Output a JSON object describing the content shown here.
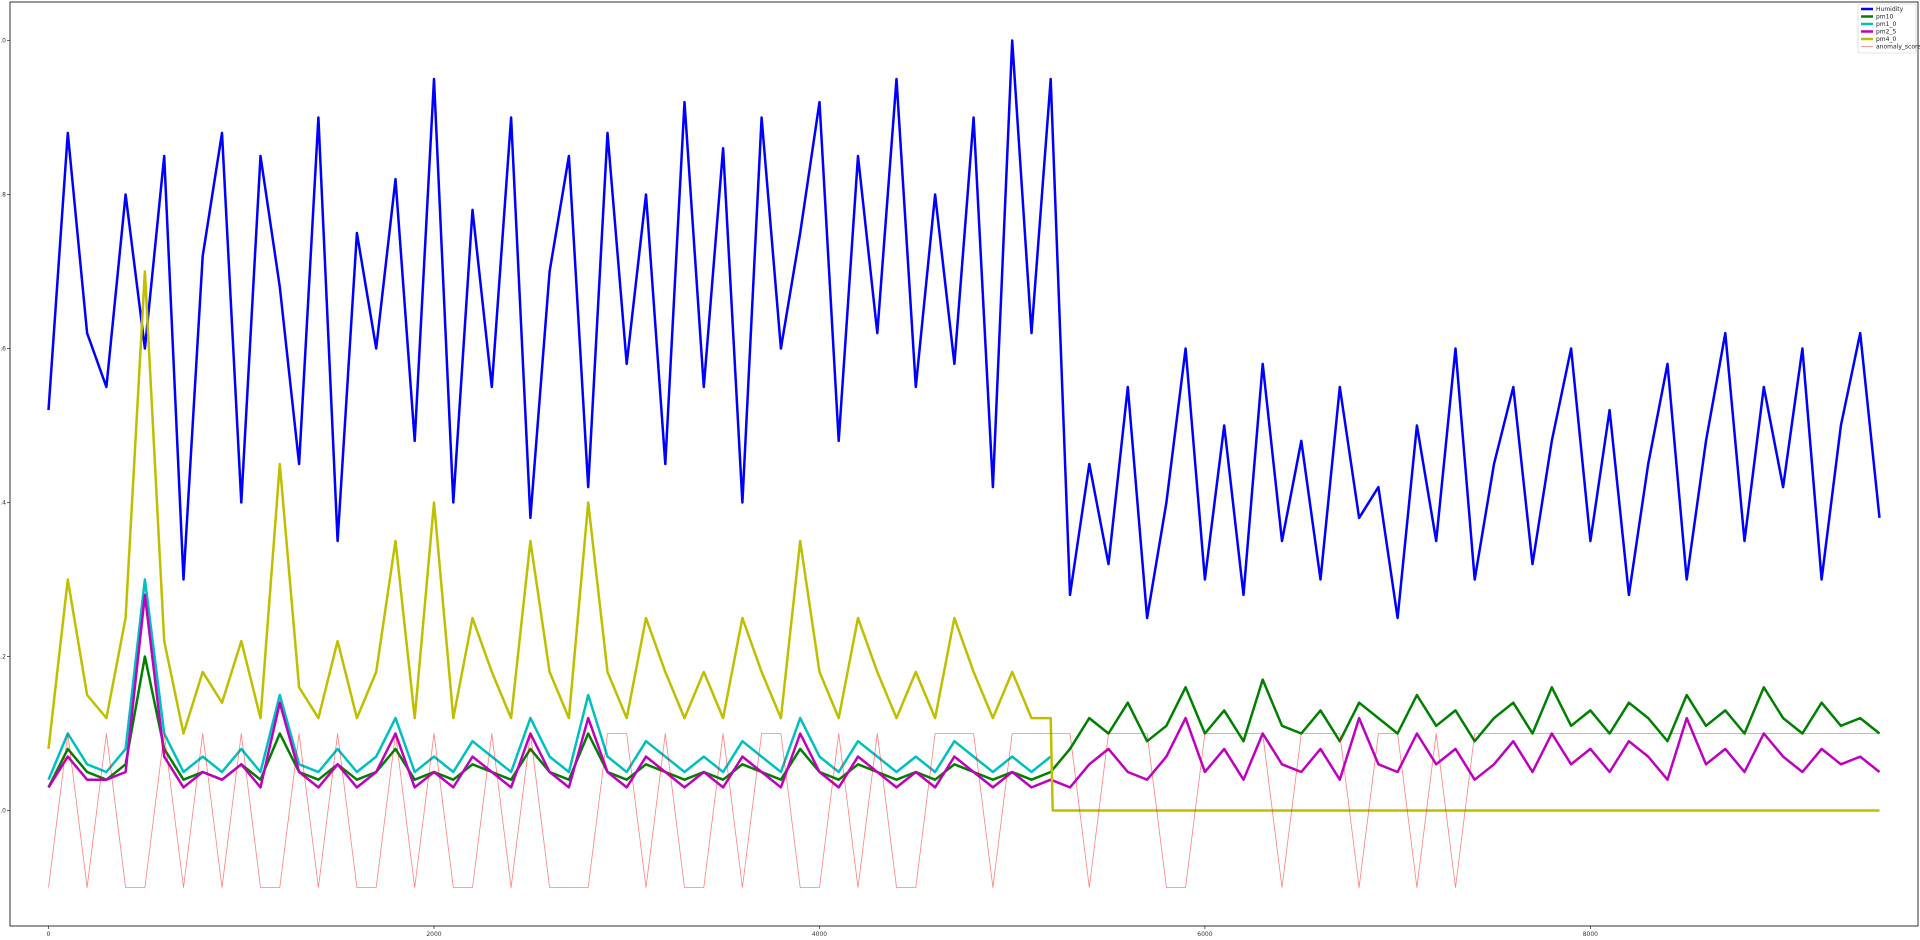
{
  "chart_data": {
    "type": "line",
    "title": "",
    "xlabel": "",
    "ylabel": "",
    "xlim": [
      -200,
      9700
    ],
    "ylim": [
      -0.15,
      1.05
    ],
    "grid": false,
    "legend_position": "top-right",
    "x_ticks": [
      0,
      2000,
      4000,
      6000,
      8000
    ],
    "x_tick_labels": [
      "0",
      "2000",
      "4000",
      "6000",
      "8000"
    ],
    "y_ticks": [
      0.0,
      0.2,
      0.4,
      0.6,
      0.8,
      1.0
    ],
    "y_tick_labels": [
      "0.0",
      "0.2",
      "0.4",
      "0.6",
      "0.8",
      "1.0"
    ],
    "n_points": 9500,
    "series": [
      {
        "name": "Humidity",
        "color": "#0000ff",
        "linewidth": 2.5,
        "x": [
          0,
          100,
          200,
          300,
          400,
          500,
          600,
          700,
          800,
          900,
          1000,
          1100,
          1200,
          1300,
          1400,
          1500,
          1600,
          1700,
          1800,
          1900,
          2000,
          2100,
          2200,
          2300,
          2400,
          2500,
          2600,
          2700,
          2800,
          2900,
          3000,
          3100,
          3200,
          3300,
          3400,
          3500,
          3600,
          3700,
          3800,
          3900,
          4000,
          4100,
          4200,
          4300,
          4400,
          4500,
          4600,
          4700,
          4800,
          4900,
          5000,
          5100,
          5200,
          5300,
          5400,
          5500,
          5600,
          5700,
          5800,
          5900,
          6000,
          6100,
          6200,
          6300,
          6400,
          6500,
          6600,
          6700,
          6800,
          6900,
          7000,
          7100,
          7200,
          7300,
          7400,
          7500,
          7600,
          7700,
          7800,
          7900,
          8000,
          8100,
          8200,
          8300,
          8400,
          8500,
          8600,
          8700,
          8800,
          8900,
          9000,
          9100,
          9200,
          9300,
          9400,
          9500
        ],
        "values": [
          0.52,
          0.88,
          0.62,
          0.55,
          0.8,
          0.6,
          0.85,
          0.3,
          0.72,
          0.88,
          0.4,
          0.85,
          0.68,
          0.45,
          0.9,
          0.35,
          0.75,
          0.6,
          0.82,
          0.48,
          0.95,
          0.4,
          0.78,
          0.55,
          0.9,
          0.38,
          0.7,
          0.85,
          0.42,
          0.88,
          0.58,
          0.8,
          0.45,
          0.92,
          0.55,
          0.86,
          0.4,
          0.9,
          0.6,
          0.75,
          0.92,
          0.48,
          0.85,
          0.62,
          0.95,
          0.55,
          0.8,
          0.58,
          0.9,
          0.42,
          1.0,
          0.62,
          0.95,
          0.28,
          0.45,
          0.32,
          0.55,
          0.25,
          0.4,
          0.6,
          0.3,
          0.5,
          0.28,
          0.58,
          0.35,
          0.48,
          0.3,
          0.55,
          0.38,
          0.42,
          0.25,
          0.5,
          0.35,
          0.6,
          0.3,
          0.45,
          0.55,
          0.32,
          0.48,
          0.6,
          0.35,
          0.52,
          0.28,
          0.45,
          0.58,
          0.3,
          0.48,
          0.62,
          0.35,
          0.55,
          0.42,
          0.6,
          0.3,
          0.5,
          0.62,
          0.38
        ]
      },
      {
        "name": "pm10",
        "color": "#008000",
        "linewidth": 2.5,
        "x": [
          0,
          100,
          200,
          300,
          400,
          500,
          600,
          700,
          800,
          900,
          1000,
          1100,
          1200,
          1300,
          1400,
          1500,
          1600,
          1700,
          1800,
          1900,
          2000,
          2100,
          2200,
          2300,
          2400,
          2500,
          2600,
          2700,
          2800,
          2900,
          3000,
          3100,
          3200,
          3300,
          3400,
          3500,
          3600,
          3700,
          3800,
          3900,
          4000,
          4100,
          4200,
          4300,
          4400,
          4500,
          4600,
          4700,
          4800,
          4900,
          5000,
          5100,
          5200,
          5300,
          5400,
          5500,
          5600,
          5700,
          5800,
          5900,
          6000,
          6100,
          6200,
          6300,
          6400,
          6500,
          6600,
          6700,
          6800,
          6900,
          7000,
          7100,
          7200,
          7300,
          7400,
          7500,
          7600,
          7700,
          7800,
          7900,
          8000,
          8100,
          8200,
          8300,
          8400,
          8500,
          8600,
          8700,
          8800,
          8900,
          9000,
          9100,
          9200,
          9300,
          9400,
          9500
        ],
        "values": [
          0.03,
          0.08,
          0.05,
          0.04,
          0.06,
          0.2,
          0.08,
          0.04,
          0.05,
          0.04,
          0.06,
          0.04,
          0.1,
          0.05,
          0.04,
          0.06,
          0.04,
          0.05,
          0.08,
          0.04,
          0.05,
          0.04,
          0.06,
          0.05,
          0.04,
          0.08,
          0.05,
          0.04,
          0.1,
          0.05,
          0.04,
          0.06,
          0.05,
          0.04,
          0.05,
          0.04,
          0.06,
          0.05,
          0.04,
          0.08,
          0.05,
          0.04,
          0.06,
          0.05,
          0.04,
          0.05,
          0.04,
          0.06,
          0.05,
          0.04,
          0.05,
          0.04,
          0.05,
          0.08,
          0.12,
          0.1,
          0.14,
          0.09,
          0.11,
          0.16,
          0.1,
          0.13,
          0.09,
          0.17,
          0.11,
          0.1,
          0.13,
          0.09,
          0.14,
          0.12,
          0.1,
          0.15,
          0.11,
          0.13,
          0.09,
          0.12,
          0.14,
          0.1,
          0.16,
          0.11,
          0.13,
          0.1,
          0.14,
          0.12,
          0.09,
          0.15,
          0.11,
          0.13,
          0.1,
          0.16,
          0.12,
          0.1,
          0.14,
          0.11,
          0.12,
          0.1
        ]
      },
      {
        "name": "pm1_0",
        "color": "#00bfbf",
        "linewidth": 2.5,
        "x": [
          0,
          100,
          200,
          300,
          400,
          500,
          600,
          700,
          800,
          900,
          1000,
          1100,
          1200,
          1300,
          1400,
          1500,
          1600,
          1700,
          1800,
          1900,
          2000,
          2100,
          2200,
          2300,
          2400,
          2500,
          2600,
          2700,
          2800,
          2900,
          3000,
          3100,
          3200,
          3300,
          3400,
          3500,
          3600,
          3700,
          3800,
          3900,
          4000,
          4100,
          4200,
          4300,
          4400,
          4500,
          4600,
          4700,
          4800,
          4900,
          5000,
          5100,
          5200
        ],
        "values": [
          0.04,
          0.1,
          0.06,
          0.05,
          0.08,
          0.3,
          0.1,
          0.05,
          0.07,
          0.05,
          0.08,
          0.05,
          0.15,
          0.06,
          0.05,
          0.08,
          0.05,
          0.07,
          0.12,
          0.05,
          0.07,
          0.05,
          0.09,
          0.07,
          0.05,
          0.12,
          0.07,
          0.05,
          0.15,
          0.07,
          0.05,
          0.09,
          0.07,
          0.05,
          0.07,
          0.05,
          0.09,
          0.07,
          0.05,
          0.12,
          0.07,
          0.05,
          0.09,
          0.07,
          0.05,
          0.07,
          0.05,
          0.09,
          0.07,
          0.05,
          0.07,
          0.05,
          0.07
        ]
      },
      {
        "name": "pm2_5",
        "color": "#bf00bf",
        "linewidth": 2.5,
        "x": [
          0,
          100,
          200,
          300,
          400,
          500,
          600,
          700,
          800,
          900,
          1000,
          1100,
          1200,
          1300,
          1400,
          1500,
          1600,
          1700,
          1800,
          1900,
          2000,
          2100,
          2200,
          2300,
          2400,
          2500,
          2600,
          2700,
          2800,
          2900,
          3000,
          3100,
          3200,
          3300,
          3400,
          3500,
          3600,
          3700,
          3800,
          3900,
          4000,
          4100,
          4200,
          4300,
          4400,
          4500,
          4600,
          4700,
          4800,
          4900,
          5000,
          5100,
          5200,
          5300,
          5400,
          5500,
          5600,
          5700,
          5800,
          5900,
          6000,
          6100,
          6200,
          6300,
          6400,
          6500,
          6600,
          6700,
          6800,
          6900,
          7000,
          7100,
          7200,
          7300,
          7400,
          7500,
          7600,
          7700,
          7800,
          7900,
          8000,
          8100,
          8200,
          8300,
          8400,
          8500,
          8600,
          8700,
          8800,
          8900,
          9000,
          9100,
          9200,
          9300,
          9400,
          9500
        ],
        "values": [
          0.03,
          0.07,
          0.04,
          0.04,
          0.05,
          0.28,
          0.07,
          0.03,
          0.05,
          0.04,
          0.06,
          0.03,
          0.14,
          0.05,
          0.03,
          0.06,
          0.03,
          0.05,
          0.1,
          0.03,
          0.05,
          0.03,
          0.07,
          0.05,
          0.03,
          0.1,
          0.05,
          0.03,
          0.12,
          0.05,
          0.03,
          0.07,
          0.05,
          0.03,
          0.05,
          0.03,
          0.07,
          0.05,
          0.03,
          0.1,
          0.05,
          0.03,
          0.07,
          0.05,
          0.03,
          0.05,
          0.03,
          0.07,
          0.05,
          0.03,
          0.05,
          0.03,
          0.04,
          0.03,
          0.06,
          0.08,
          0.05,
          0.04,
          0.07,
          0.12,
          0.05,
          0.08,
          0.04,
          0.1,
          0.06,
          0.05,
          0.08,
          0.04,
          0.12,
          0.06,
          0.05,
          0.1,
          0.06,
          0.08,
          0.04,
          0.06,
          0.09,
          0.05,
          0.1,
          0.06,
          0.08,
          0.05,
          0.09,
          0.07,
          0.04,
          0.12,
          0.06,
          0.08,
          0.05,
          0.1,
          0.07,
          0.05,
          0.08,
          0.06,
          0.07,
          0.05
        ]
      },
      {
        "name": "pm4_0",
        "color": "#bfbf00",
        "linewidth": 2.5,
        "x": [
          0,
          100,
          200,
          300,
          400,
          500,
          600,
          700,
          800,
          900,
          1000,
          1100,
          1200,
          1300,
          1400,
          1500,
          1600,
          1700,
          1800,
          1900,
          2000,
          2100,
          2200,
          2300,
          2400,
          2500,
          2600,
          2700,
          2800,
          2900,
          3000,
          3100,
          3200,
          3300,
          3400,
          3500,
          3600,
          3700,
          3800,
          3900,
          4000,
          4100,
          4200,
          4300,
          4400,
          4500,
          4600,
          4700,
          4800,
          4900,
          5000,
          5100,
          5200,
          5210,
          9500
        ],
        "values": [
          0.08,
          0.3,
          0.15,
          0.12,
          0.25,
          0.7,
          0.22,
          0.1,
          0.18,
          0.14,
          0.22,
          0.12,
          0.45,
          0.16,
          0.12,
          0.22,
          0.12,
          0.18,
          0.35,
          0.12,
          0.4,
          0.12,
          0.25,
          0.18,
          0.12,
          0.35,
          0.18,
          0.12,
          0.4,
          0.18,
          0.12,
          0.25,
          0.18,
          0.12,
          0.18,
          0.12,
          0.25,
          0.18,
          0.12,
          0.35,
          0.18,
          0.12,
          0.25,
          0.18,
          0.12,
          0.18,
          0.12,
          0.25,
          0.18,
          0.12,
          0.18,
          0.12,
          0.12,
          0.0,
          0.0
        ]
      },
      {
        "name": "anomaly_score",
        "color": "#ff0000",
        "linewidth": 0.8,
        "alpha": 0.5,
        "x": [
          0,
          100,
          200,
          300,
          400,
          500,
          600,
          700,
          800,
          900,
          1000,
          1100,
          1200,
          1300,
          1400,
          1500,
          1600,
          1700,
          1800,
          1900,
          2000,
          2100,
          2200,
          2300,
          2400,
          2500,
          2600,
          2700,
          2800,
          2900,
          3000,
          3100,
          3200,
          3300,
          3400,
          3500,
          3600,
          3700,
          3800,
          3900,
          4000,
          4100,
          4200,
          4300,
          4400,
          4500,
          4600,
          4700,
          4800,
          4900,
          5000,
          5100,
          5200,
          5300,
          5400,
          5500,
          5600,
          5700,
          5800,
          5900,
          6000,
          6100,
          6200,
          6300,
          6400,
          6500,
          6600,
          6700,
          6800,
          6900,
          7000,
          7100,
          7200,
          7300,
          7400,
          7500,
          7600,
          7700,
          7800,
          7900,
          8000,
          8100,
          8200,
          8300,
          8400,
          8500,
          8600,
          8700,
          8800,
          8900,
          9000,
          9100,
          9200,
          9300,
          9400,
          9500
        ],
        "values": [
          -0.1,
          0.1,
          -0.1,
          0.1,
          -0.1,
          -0.1,
          0.1,
          -0.1,
          0.1,
          -0.1,
          0.1,
          -0.1,
          -0.1,
          0.1,
          -0.1,
          0.1,
          -0.1,
          -0.1,
          0.1,
          -0.1,
          0.1,
          -0.1,
          -0.1,
          0.1,
          -0.1,
          0.1,
          -0.1,
          -0.1,
          -0.1,
          0.1,
          0.1,
          -0.1,
          0.1,
          -0.1,
          -0.1,
          0.1,
          -0.1,
          0.1,
          0.1,
          -0.1,
          -0.1,
          0.1,
          -0.1,
          0.1,
          -0.1,
          -0.1,
          0.1,
          0.1,
          0.1,
          -0.1,
          0.1,
          0.1,
          0.1,
          0.1,
          -0.1,
          0.1,
          0.1,
          0.1,
          -0.1,
          -0.1,
          0.1,
          0.1,
          0.1,
          0.1,
          -0.1,
          0.1,
          0.1,
          0.1,
          -0.1,
          0.1,
          0.1,
          -0.1,
          0.1,
          -0.1,
          0.1,
          0.1,
          0.1,
          0.1,
          0.1,
          0.1,
          0.1,
          0.1,
          0.1,
          0.1,
          0.1,
          0.1,
          0.1,
          0.1,
          0.1,
          0.1,
          0.1,
          0.1,
          0.1,
          0.1,
          0.1,
          0.1
        ]
      }
    ]
  }
}
